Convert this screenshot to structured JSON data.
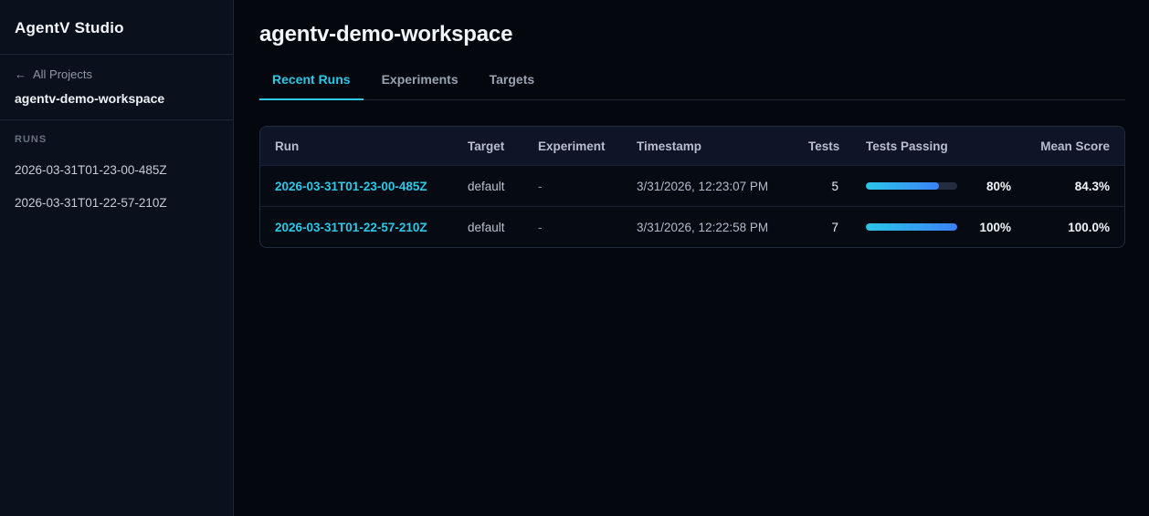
{
  "colors": {
    "accent": "#2cc9e8",
    "bar_start": "#29c6e8",
    "bar_end": "#3b82f6",
    "sidebar_bg": "#0b111c",
    "main_bg": "#04070d"
  },
  "sidebar": {
    "app_title": "AgentV Studio",
    "back_arrow": "←",
    "back_label": "All Projects",
    "workspace_name": "agentv-demo-workspace",
    "runs_label": "RUNS",
    "runs": [
      "2026-03-31T01-23-00-485Z",
      "2026-03-31T01-22-57-210Z"
    ]
  },
  "main": {
    "title": "agentv-demo-workspace",
    "tabs": [
      {
        "label": "Recent Runs",
        "active": true
      },
      {
        "label": "Experiments",
        "active": false
      },
      {
        "label": "Targets",
        "active": false
      }
    ],
    "table": {
      "headers": [
        "Run",
        "Target",
        "Experiment",
        "Timestamp",
        "Tests",
        "Tests Passing",
        "Mean Score"
      ],
      "rows": [
        {
          "run": "2026-03-31T01-23-00-485Z",
          "target": "default",
          "experiment": "-",
          "timestamp": "3/31/2026, 12:23:07 PM",
          "tests": "5",
          "passing_pct": 80,
          "passing_label": "80%",
          "mean_score": "84.3%"
        },
        {
          "run": "2026-03-31T01-22-57-210Z",
          "target": "default",
          "experiment": "-",
          "timestamp": "3/31/2026, 12:22:58 PM",
          "tests": "7",
          "passing_pct": 100,
          "passing_label": "100%",
          "mean_score": "100.0%"
        }
      ]
    }
  }
}
